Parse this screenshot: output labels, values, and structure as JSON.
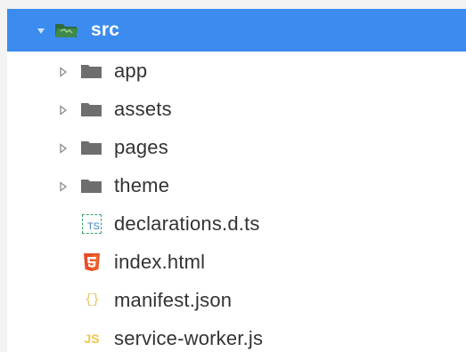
{
  "tree": {
    "root": {
      "label": "src",
      "icon": "folder-open-green-icon",
      "expanded": true,
      "selected": true
    },
    "children": [
      {
        "label": "app",
        "type": "folder",
        "icon": "folder-icon",
        "expanded": false
      },
      {
        "label": "assets",
        "type": "folder",
        "icon": "folder-icon",
        "expanded": false
      },
      {
        "label": "pages",
        "type": "folder",
        "icon": "folder-icon",
        "expanded": false
      },
      {
        "label": "theme",
        "type": "folder",
        "icon": "folder-icon",
        "expanded": false
      },
      {
        "label": "declarations.d.ts",
        "type": "file",
        "icon": "typescript-definition-icon",
        "glyph": "TS"
      },
      {
        "label": "index.html",
        "type": "file",
        "icon": "html5-icon",
        "glyph": "5"
      },
      {
        "label": "manifest.json",
        "type": "file",
        "icon": "json-icon",
        "glyph": "{}"
      },
      {
        "label": "service-worker.js",
        "type": "file",
        "icon": "javascript-icon",
        "glyph": "JS"
      }
    ]
  },
  "colors": {
    "selection": "#3c8cf0",
    "folder": "#6e6e6e",
    "root_folder": "#2f6b3a",
    "html5": "#e44d26",
    "json": "#e8c46a",
    "javascript": "#f0c64a",
    "text": "#333333"
  }
}
